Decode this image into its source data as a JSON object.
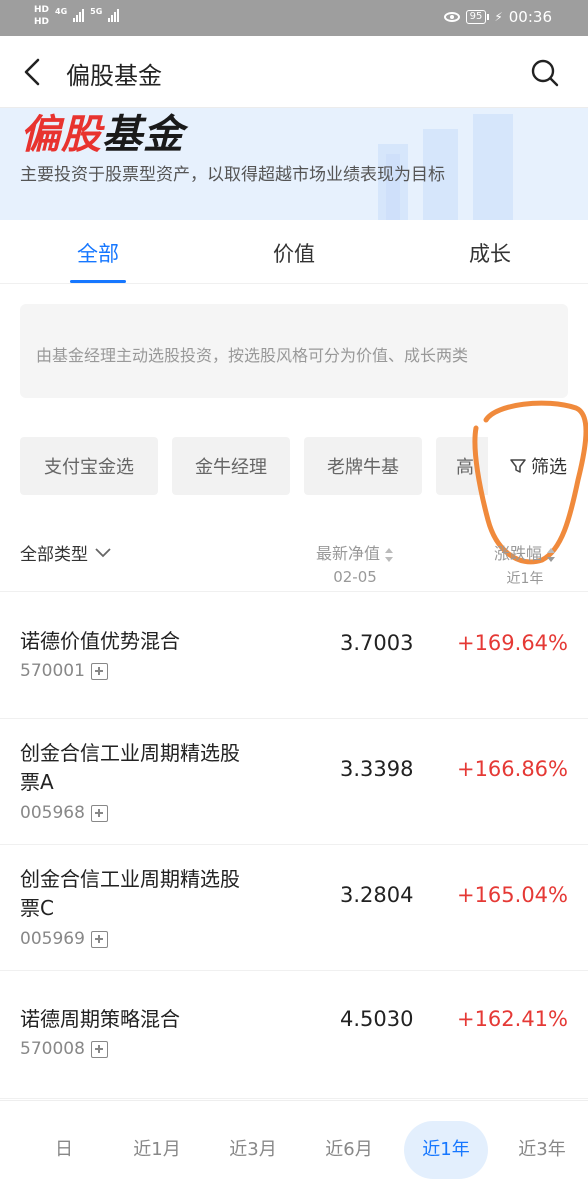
{
  "status_bar": {
    "hd1": "HD",
    "hd2": "HD",
    "net1": "4G",
    "net2": "5G",
    "battery": "95",
    "time": "00:36"
  },
  "nav": {
    "title": "偏股基金"
  },
  "banner": {
    "title_red": "偏股",
    "title_dark": "基金",
    "subtitle": "主要投资于股票型资产，以取得超越市场业绩表现为目标"
  },
  "tabs": [
    {
      "label": "全部",
      "active": true
    },
    {
      "label": "价值",
      "active": false
    },
    {
      "label": "成长",
      "active": false
    }
  ],
  "description": "由基金经理主动选股投资，按选股风格可分为价值、成长两类",
  "chips": [
    "支付宝金选",
    "金牛经理",
    "老牌牛基",
    "高"
  ],
  "filter_label": "筛选",
  "list_header": {
    "type_label": "全部类型",
    "nav_label": "最新净值",
    "nav_date": "02-05",
    "change_label": "涨跌幅",
    "change_period": "近1年"
  },
  "funds": [
    {
      "name": "诺德价值优势混合",
      "code": "570001",
      "nav": "3.7003",
      "change": "+169.64%"
    },
    {
      "name": "创金合信工业周期精选股票A",
      "code": "005968",
      "nav": "3.3398",
      "change": "+166.86%"
    },
    {
      "name": "创金合信工业周期精选股票C",
      "code": "005969",
      "nav": "3.2804",
      "change": "+165.04%"
    },
    {
      "name": "诺德周期策略混合",
      "code": "570008",
      "nav": "4.5030",
      "change": "+162.41%"
    }
  ],
  "periods": [
    {
      "label": "日",
      "active": false
    },
    {
      "label": "近1月",
      "active": false
    },
    {
      "label": "近3月",
      "active": false
    },
    {
      "label": "近6月",
      "active": false
    },
    {
      "label": "近1年",
      "active": true
    },
    {
      "label": "近3年",
      "active": false
    }
  ],
  "colors": {
    "accent": "#1677ff",
    "rise": "#e53935",
    "brand_red": "#e8332f",
    "annotation": "#f08a3c"
  }
}
